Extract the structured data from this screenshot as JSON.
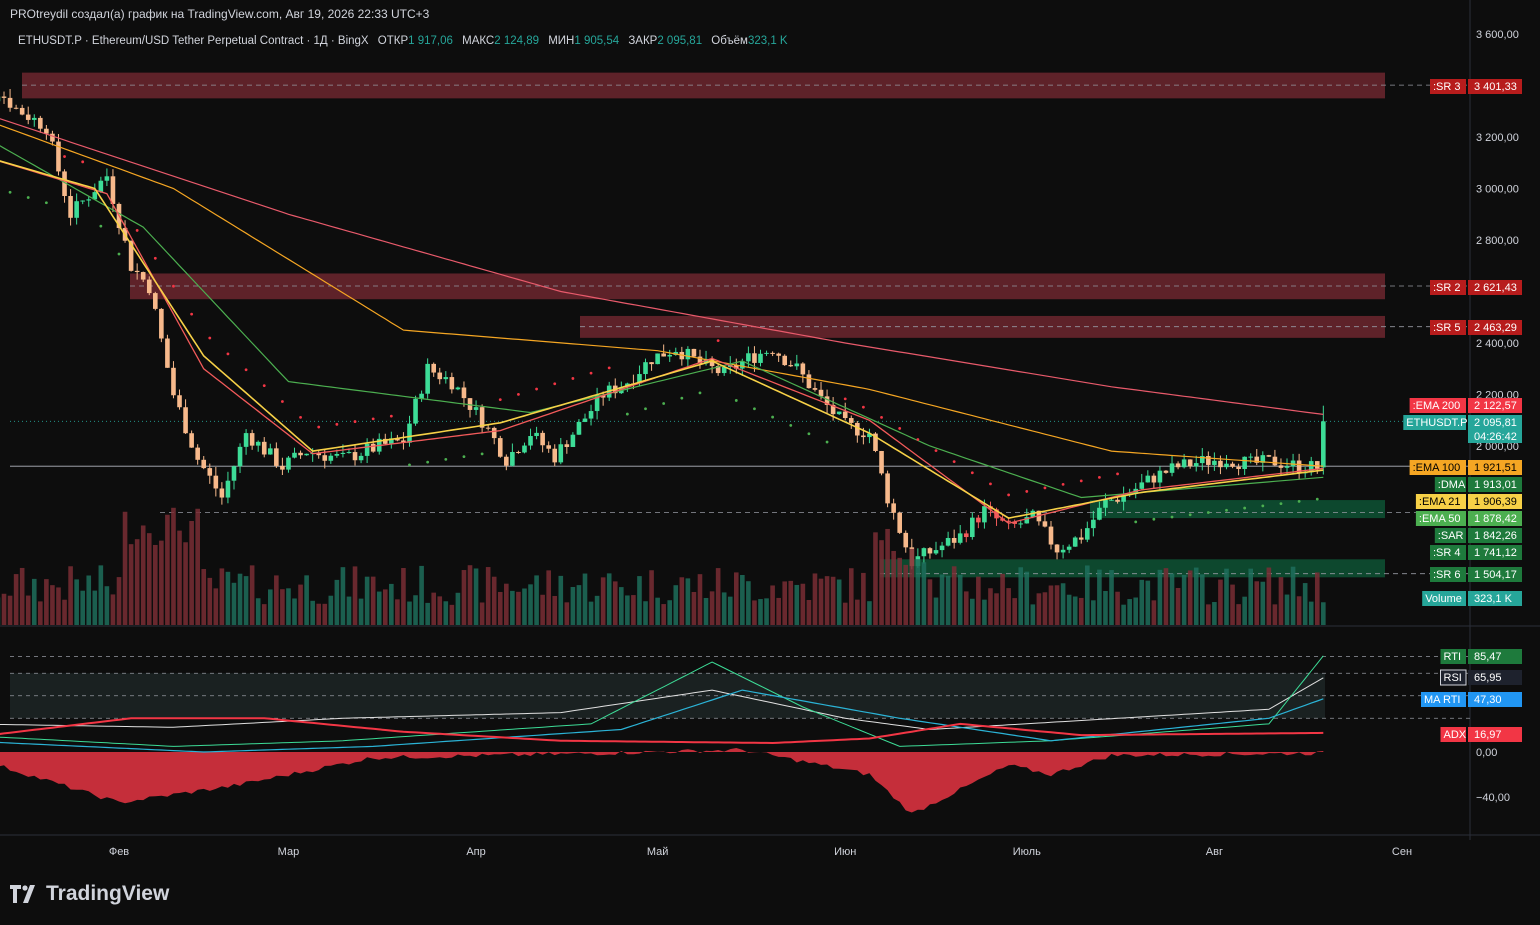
{
  "header": {
    "caption": "PROtreydil создал(а) график на TradingView.com, Авг 19, 2026 22:33 UTC+3",
    "symbol_desc": "ETHUSDT.P · Ethereum/USD Tether Perpetual Contract · 1Д · BingX",
    "open_label": "ОТКР",
    "open_value": "1 917,06",
    "high_label": "МАКС",
    "high_value": "2 124,89",
    "low_label": "МИН",
    "low_value": "1 905,54",
    "close_label": "ЗАКР",
    "close_value": "2 095,81",
    "volume_label": "Объём",
    "volume_value": "323,1 K"
  },
  "brand": {
    "name": "TradingView",
    "icon": "tradingview-logo-icon"
  },
  "colors": {
    "background": "#0d0d0d",
    "up": "#3ddc97",
    "down": "#f7b98b",
    "down_dark": "#f25a5a",
    "ema200": "#e85a6b",
    "ema100": "#f5a623",
    "ema50": "#4caf50",
    "ema21": "#f7d147",
    "dma": "#f25a5a",
    "sar_up": "#4caf50",
    "sar_down": "#f23645",
    "resistance": "#7a2a33",
    "support": "#0e5c3a",
    "rsi": "#e0e0e0",
    "rti": "#3ddc97",
    "ma_rti": "#2bb3d6",
    "adx": "#f23645"
  },
  "chart_data": [
    {
      "type": "candlestick",
      "title": "ETHUSDT.P · Ethereum/USD Tether Perpetual Contract · 1Д · BingX",
      "x": [
        "Фев",
        "Мар",
        "Апр",
        "Май",
        "Июн",
        "Июль",
        "Авг",
        "Сен"
      ],
      "y_ticks": [
        "3 600,00",
        "3 200,00",
        "3 000,00",
        "2 800,00",
        "2 400,00",
        "2 200,00",
        "2 000,00"
      ],
      "ylim": [
        1300,
        3650
      ],
      "price_path": [
        [
          "Янв 06",
          3250
        ],
        [
          "Янв 12",
          3380
        ],
        [
          "Янв 15",
          3310
        ],
        [
          "Янв 20",
          3240
        ],
        [
          "Янв 24",
          2900
        ],
        [
          "Янв 30",
          3050
        ],
        [
          "Фев 03",
          2700
        ],
        [
          "Фев 06",
          2620
        ],
        [
          "Фев 10",
          2200
        ],
        [
          "Фев 14",
          1950
        ],
        [
          "Фев 18",
          1800
        ],
        [
          "Фев 22",
          2050
        ],
        [
          "Фев 28",
          1920
        ],
        [
          "Мар 04",
          1980
        ],
        [
          "Мар 10",
          1950
        ],
        [
          "Мар 16",
          2000
        ],
        [
          "Мар 20",
          2020
        ],
        [
          "Мар 24",
          2300
        ],
        [
          "Мар 28",
          2250
        ],
        [
          "Апр 02",
          2100
        ],
        [
          "Апр 06",
          1950
        ],
        [
          "Апр 10",
          2050
        ],
        [
          "Апр 14",
          1960
        ],
        [
          "Апр 18",
          2080
        ],
        [
          "Апр 22",
          2200
        ],
        [
          "Апр 26",
          2250
        ],
        [
          "Апр 30",
          2340
        ],
        [
          "Май 04",
          2380
        ],
        [
          "Май 08",
          2320
        ],
        [
          "Май 12",
          2280
        ],
        [
          "Май 16",
          2340
        ],
        [
          "Май 20",
          2380
        ],
        [
          "Май 24",
          2300
        ],
        [
          "Май 28",
          2180
        ],
        [
          "Июн 01",
          2080
        ],
        [
          "Июн 05",
          2050
        ],
        [
          "Июн 08",
          1800
        ],
        [
          "Июн 12",
          1550
        ],
        [
          "Июн 16",
          1600
        ],
        [
          "Июн 20",
          1650
        ],
        [
          "Июн 24",
          1750
        ],
        [
          "Июн 28",
          1680
        ],
        [
          "Июл 02",
          1720
        ],
        [
          "Июл 06",
          1600
        ],
        [
          "Июл 10",
          1650
        ],
        [
          "Июл 14",
          1780
        ],
        [
          "Июл 18",
          1820
        ],
        [
          "Июл 22",
          1880
        ],
        [
          "Июл 26",
          1920
        ],
        [
          "Июл 30",
          1940
        ],
        [
          "Авг 03",
          1950
        ],
        [
          "Авг 07",
          1930
        ],
        [
          "Авг 11",
          1940
        ],
        [
          "Авг 15",
          1920
        ],
        [
          "Авг 18",
          1917
        ],
        [
          "Авг 19",
          2095.81
        ]
      ],
      "ema200_path": [
        [
          "Янв 06",
          3320
        ],
        [
          "Мар 01",
          2900
        ],
        [
          "Апр 15",
          2600
        ],
        [
          "Июн 01",
          2400
        ],
        [
          "Июл 15",
          2230
        ],
        [
          "Авг 19",
          2122.57
        ]
      ],
      "ema100_path": [
        [
          "Янв 06",
          3300
        ],
        [
          "Фев 10",
          3000
        ],
        [
          "Мар 20",
          2450
        ],
        [
          "Май 01",
          2370
        ],
        [
          "Июн 05",
          2220
        ],
        [
          "Июл 15",
          1980
        ],
        [
          "Авг 19",
          1921.51
        ]
      ],
      "ema50_path": [
        [
          "Янв 06",
          3250
        ],
        [
          "Фев 05",
          2850
        ],
        [
          "Мар 01",
          2250
        ],
        [
          "Апр 10",
          2130
        ],
        [
          "Май 15",
          2330
        ],
        [
          "Июн 15",
          2000
        ],
        [
          "Июл 10",
          1800
        ],
        [
          "Авг 19",
          1878.42
        ]
      ],
      "ema21_path": [
        [
          "Янв 06",
          3150
        ],
        [
          "Янв 28",
          3000
        ],
        [
          "Фев 15",
          2350
        ],
        [
          "Мар 05",
          1980
        ],
        [
          "Апр 05",
          2090
        ],
        [
          "Май 10",
          2330
        ],
        [
          "Июн 05",
          2050
        ],
        [
          "Июн 28",
          1720
        ],
        [
          "Июл 20",
          1820
        ],
        [
          "Авг 19",
          1906.39
        ]
      ],
      "dma_path": [
        [
          "Янв 06",
          3150
        ],
        [
          "Янв 30",
          2980
        ],
        [
          "Фев 15",
          2300
        ],
        [
          "Мар 05",
          1970
        ],
        [
          "Апр 05",
          2060
        ],
        [
          "Май 10",
          2340
        ],
        [
          "Июн 05",
          2100
        ],
        [
          "Июн 28",
          1700
        ],
        [
          "Июл 20",
          1830
        ],
        [
          "Авг 19",
          1913.01
        ]
      ],
      "levels": [
        {
          "name": "SR 3",
          "label": "3 401,33",
          "value": 3401.33,
          "zone": [
            3350,
            3450
          ],
          "color": "#7a2a33"
        },
        {
          "name": "SR 2",
          "label": "2 621,43",
          "value": 2621.43,
          "zone": [
            2570,
            2670
          ],
          "color": "#7a2a33"
        },
        {
          "name": "SR 5",
          "label": "2 463,29",
          "value": 2463.29,
          "zone": [
            2420,
            2505
          ],
          "color": "#7a2a33"
        },
        {
          "name": "SR 4",
          "label": "1 741,12",
          "value": 1741.12,
          "zone": [
            1720,
            1790
          ],
          "color": "#0e5c3a"
        },
        {
          "name": "SR 6",
          "label": "1 504,17",
          "value": 1504.17,
          "zone": [
            1490,
            1560
          ],
          "color": "#0e5c3a"
        }
      ],
      "price_labels": [
        {
          "name": "EMA 200",
          "value": "2 122,57",
          "color": "#f23645"
        },
        {
          "name": "ETHUSDT.P",
          "value": "2 095,81",
          "extra": "04:26:42",
          "color": "#26a69a"
        },
        {
          "name": "EMA 100",
          "value": "1 921,51",
          "color": "#f5a623"
        },
        {
          "name": "DMA",
          "value": "1 913,01",
          "color": "#1e7a3c"
        },
        {
          "name": "EMA 21",
          "value": "1 906,39",
          "color": "#f7d147"
        },
        {
          "name": "EMA 50",
          "value": "1 878,42",
          "color": "#4caf50"
        },
        {
          "name": "SAR",
          "value": "1 842,26",
          "color": "#1e7a3c"
        },
        {
          "name": "Volume",
          "value": "323,1 K",
          "color": "#26a69a"
        }
      ]
    },
    {
      "type": "line",
      "title": "",
      "y_ticks": [
        "0,00",
        "−40,00"
      ],
      "ylim": [
        -55,
        85
      ],
      "rsi_path": [
        [
          "Янв 06",
          25
        ],
        [
          "Фев 10",
          22
        ],
        [
          "Мар 10",
          30
        ],
        [
          "Апр 15",
          35
        ],
        [
          "Май 10",
          55
        ],
        [
          "Июн 01",
          30
        ],
        [
          "Июн 15",
          20
        ],
        [
          "Июл 10",
          28
        ],
        [
          "Авг 10",
          38
        ],
        [
          "Авг 19",
          65.95
        ]
      ],
      "rti_path": [
        [
          "Янв 06",
          15
        ],
        [
          "Фев 10",
          5
        ],
        [
          "Мар 10",
          10
        ],
        [
          "Апр 20",
          25
        ],
        [
          "Май 10",
          80
        ],
        [
          "Май 25",
          40
        ],
        [
          "Июн 10",
          5
        ],
        [
          "Июл 05",
          10
        ],
        [
          "Авг 10",
          25
        ],
        [
          "Авг 19",
          85.47
        ]
      ],
      "ma_rti_path": [
        [
          "Янв 06",
          10
        ],
        [
          "Фев 15",
          0
        ],
        [
          "Мар 15",
          5
        ],
        [
          "Апр 25",
          20
        ],
        [
          "Май 15",
          55
        ],
        [
          "Июн 10",
          30
        ],
        [
          "Июл 05",
          10
        ],
        [
          "Авг 10",
          30
        ],
        [
          "Авг 19",
          47.3
        ]
      ],
      "adx_path": [
        [
          "Янв 06",
          12
        ],
        [
          "Фев 03",
          30
        ],
        [
          "Фев 25",
          30
        ],
        [
          "Мар 20",
          18
        ],
        [
          "Апр 15",
          10
        ],
        [
          "Май 20",
          8
        ],
        [
          "Июн 05",
          12
        ],
        [
          "Июн 20",
          25
        ],
        [
          "Июл 10",
          15
        ],
        [
          "Авг 19",
          16.97
        ]
      ],
      "hist_path": [
        [
          "Янв 06",
          -2
        ],
        [
          "Фев 01",
          -45
        ],
        [
          "Фев 20",
          -30
        ],
        [
          "Мар 15",
          -5
        ],
        [
          "Апр 15",
          -2
        ],
        [
          "Май 15",
          2
        ],
        [
          "Июн 05",
          -20
        ],
        [
          "Июн 12",
          -55
        ],
        [
          "Июн 28",
          -12
        ],
        [
          "Июл 05",
          -20
        ],
        [
          "Июл 15",
          -3
        ],
        [
          "Авг 19",
          -1
        ]
      ],
      "labels": [
        {
          "name": "RTI",
          "value": "85,47",
          "color": "#1e7a3c"
        },
        {
          "name": "RSI",
          "value": "65,95",
          "color": "#d1d4dc"
        },
        {
          "name": "MA RTI",
          "value": "47,30",
          "color": "#2196f3"
        },
        {
          "name": "ADX",
          "value": "16,97",
          "color": "#f23645"
        }
      ]
    }
  ]
}
